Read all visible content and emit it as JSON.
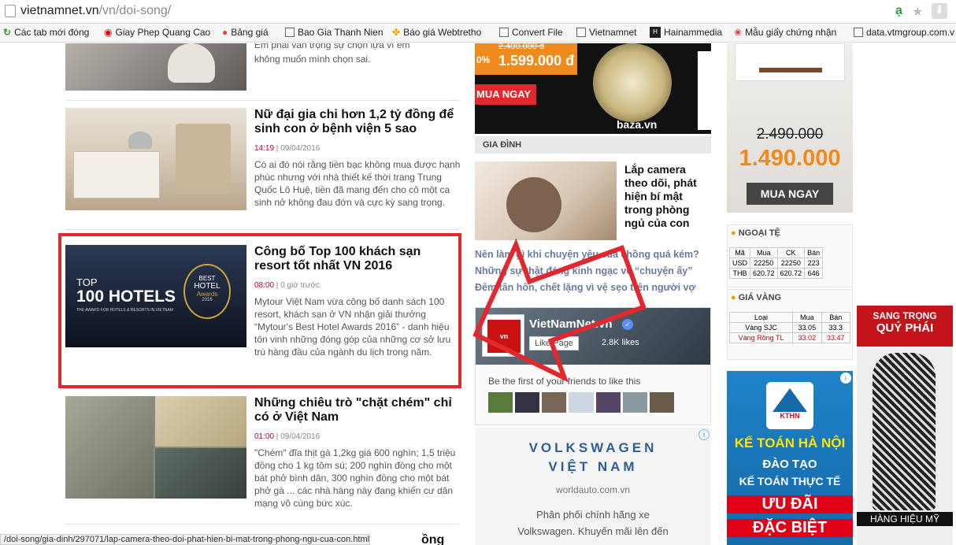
{
  "browser": {
    "url_domain": "vietnamnet.vn",
    "url_path": "/vn/doi-song/",
    "bookmarks": [
      "Các tab mới đóng",
      "Giay Phep Quang Cao",
      "Bảng giá",
      "Bao Gia Thanh Nien",
      "Báo giá Webtretho",
      "Convert File",
      "Vietnamnet",
      "Hainammedia",
      "Mẫu giấy chứng nhận",
      "data.vtmgroup.com.v"
    ],
    "status_url": "/doi-song/gia-dinh/297071/lap-camera-theo-doi-phat-hien-bi-mat-trong-phong-ngu-cua-con.html"
  },
  "articles": [
    {
      "title": "",
      "summary": "không muốn mình chọn sai.",
      "summary_partial": "Em phải vấn trọng sự chọn lựa vì em"
    },
    {
      "title": "Nữ đại gia chi hơn 1,2 tỷ đồng để sinh con ở bệnh viện 5 sao",
      "time": "14:19",
      "date": "09/04/2016",
      "summary": "Có ai đó nói rằng tiền bạc không mua được hạnh phúc nhưng với nhà thiết kế thời trang Trung Quốc Lô Huệ, tiền đã mang đến cho cô một ca sinh nở không đau đớn và cực kỳ sang trọng."
    },
    {
      "title": "Công bố Top 100 khách sạn resort tốt nhất VN 2016",
      "time": "08:00",
      "date": "0 giờ trước",
      "summary": "Mytour Việt Nam vừa công bố danh sách 100 resort, khách sạn ở VN nhận giải thưởng “Mytour's Best Hotel Awards 2016” - danh hiệu tôn vinh những đóng góp của những cơ sở lưu trú hàng đầu của ngành du lịch trong năm.",
      "thumb_text_top": "TOP",
      "thumb_text_main": "100 HOTELS",
      "thumb_text_sub": "THE AWARD FOR HOTELS & RESORTS IN VIETNAM",
      "thumb_badge_1": "BEST",
      "thumb_badge_2": "HOTEL",
      "thumb_badge_3": "Awards",
      "thumb_badge_4": "2016"
    },
    {
      "title": "Những chiêu trò \"chặt chém\" chỉ có ở Việt Nam",
      "time": "01:00",
      "date": "09/04/2016",
      "summary": "\"Chém\" đĩa thịt gà 1,2kg giá 600 nghìn; 1,5 triệu đồng cho 1 kg tôm sú; 200 nghìn đồng cho một bát phở bình dân, 300 nghìn đồng cho một bát phở gà ... các nhà hàng này đang khiến cư dân mạng vô cùng bức xúc."
    },
    {
      "title_partial": "ồng"
    }
  ],
  "middle": {
    "watch_ad_price_old": "2.400.000 đ",
    "watch_ad_price_new": "1.599.000 đ",
    "watch_ad_prefix": "0%",
    "watch_ad_cta": "MUA NGAY",
    "watch_ad_brand": "baza.vn",
    "section": "GIA ĐÌNH",
    "featured_title": "Lắp camera theo dõi, phát hiện bí mật trong phòng ngủ của con",
    "links": [
      "Nên làm gì khi chuyện yêu của chồng quá kém?",
      "Những sự thật đáng kinh ngạc về “chuyện ấy”",
      "Đêm tân hôn, chết lặng vì vệ sẹo trên người vợ"
    ],
    "fb_page": "VietNamNet.vn",
    "fb_like_label": "Like Page",
    "fb_likes": "2.8K likes",
    "fb_friends": "Be the first of your friends to like this",
    "vw_brand_line1": "VOLKSWAGEN",
    "vw_brand_line2": "VIỆT NAM",
    "vw_url": "worldauto.com.vn",
    "vw_desc_1": "Phân phối chính hãng xe",
    "vw_desc_2": "Volkswagen. Khuyến mãi lên đến"
  },
  "right": {
    "tshirt_price_old": "2.490.000",
    "tshirt_price_new": "1.490.000",
    "tshirt_cta": "MUA NGAY",
    "forex_title": "NGOẠI TỆ",
    "forex_headers": [
      "Mã",
      "Mua",
      "CK",
      "Bán"
    ],
    "forex_rows": [
      [
        "USD",
        "22250",
        "22250",
        "223"
      ],
      [
        "THB",
        "620.72",
        "620.72",
        "646"
      ]
    ],
    "gold_title": "GIÁ VÀNG",
    "gold_headers": [
      "Loại",
      "Mua",
      "Bán"
    ],
    "gold_rows": [
      [
        "Vàng SJC",
        "33.05",
        "33.3"
      ],
      [
        "Vàng Rồng TL",
        "33.02",
        "33.47"
      ]
    ],
    "kthn_logo": "KTHN",
    "kthn_1": "KẾ TOÁN HÀ NỘI",
    "kthn_2": "ĐÀO TẠO",
    "kthn_3": "KẾ TOÁN THỰC TẾ",
    "kthn_4": "ƯU ĐÃI",
    "kthn_5": "ĐẶC BIỆT",
    "fashion_1": "SANG TRỌNG",
    "fashion_2": "QUÝ PHÁI",
    "fashion_3": "HÀNG HIỆU MỸ"
  },
  "colors": {
    "highlight": "#e0282e",
    "time_red": "#d0021b",
    "ad_orange": "#f08a1c",
    "kthn_red": "#e10016"
  }
}
